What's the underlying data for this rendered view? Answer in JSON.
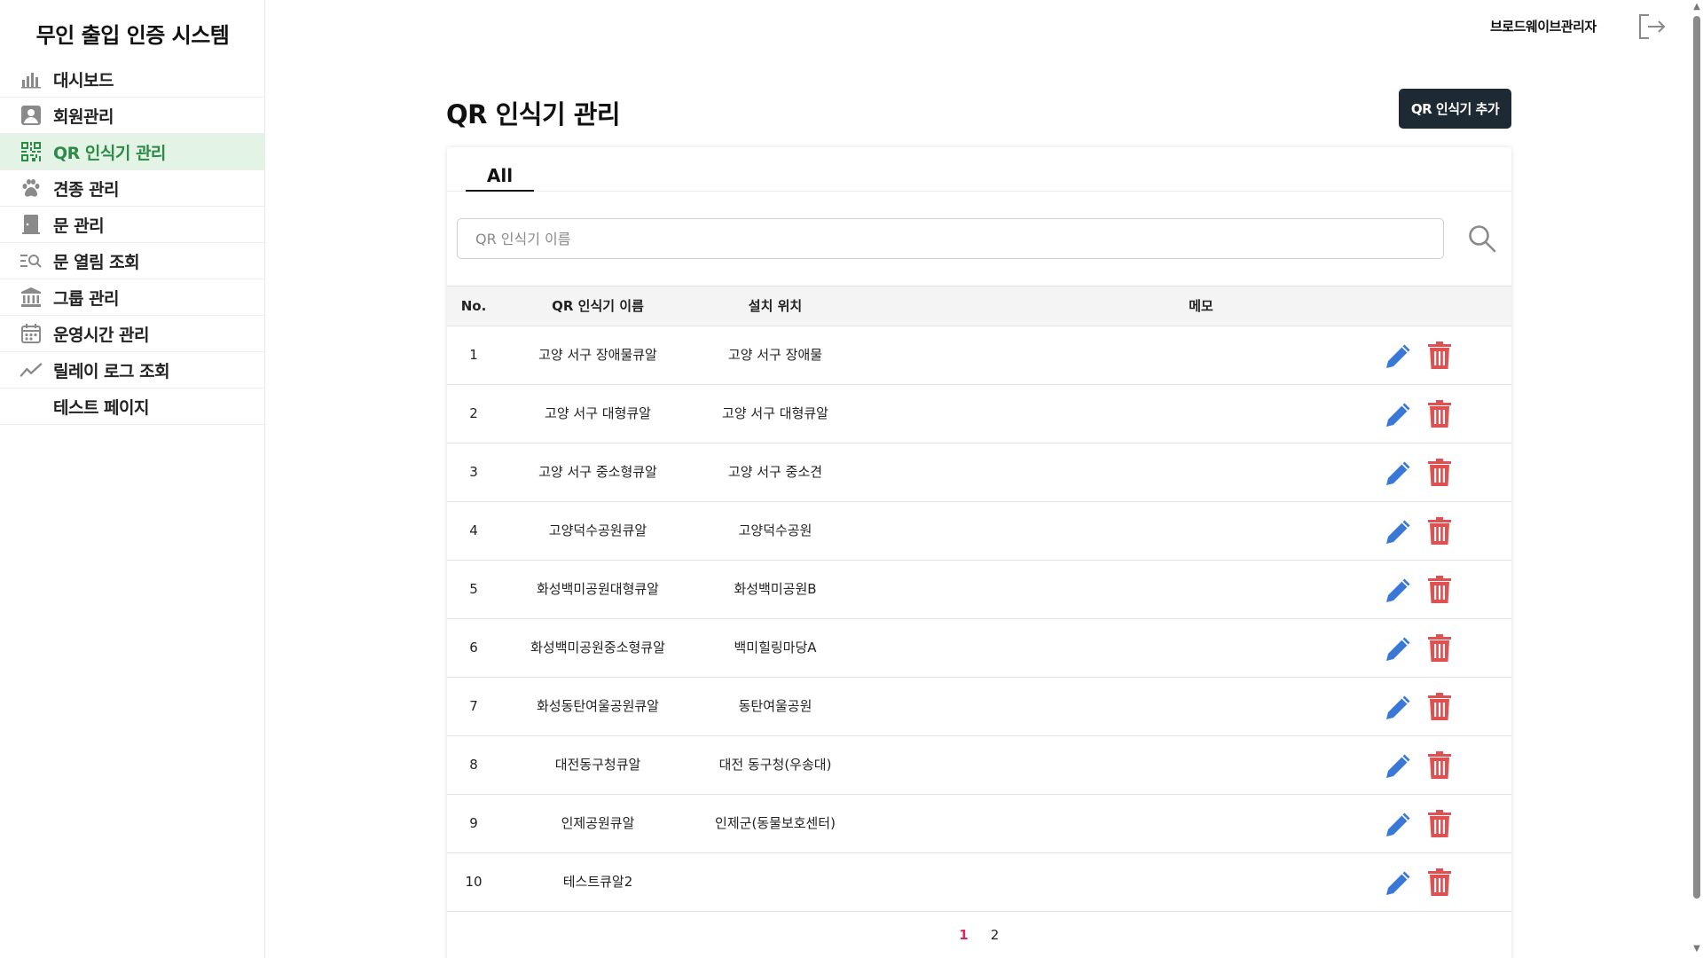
{
  "app": {
    "title": "무인 출입 인증 시스템"
  },
  "sidebar": {
    "items": [
      {
        "label": "대시보드",
        "icon": "bar-chart-icon",
        "active": false
      },
      {
        "label": "회원관리",
        "icon": "user-card-icon",
        "active": false
      },
      {
        "label": "QR 인식기 관리",
        "icon": "qr-code-icon",
        "active": true
      },
      {
        "label": "견종 관리",
        "icon": "paw-icon",
        "active": false
      },
      {
        "label": "문 관리",
        "icon": "door-icon",
        "active": false
      },
      {
        "label": "문 열림 조회",
        "icon": "list-search-icon",
        "active": false
      },
      {
        "label": "그룹 관리",
        "icon": "institution-icon",
        "active": false
      },
      {
        "label": "운영시간 관리",
        "icon": "calendar-icon",
        "active": false
      },
      {
        "label": "릴레이 로그 조회",
        "icon": "trend-line-icon",
        "active": false
      },
      {
        "label": "테스트 페이지",
        "icon": "",
        "active": false
      }
    ]
  },
  "header": {
    "admin_name": "브로드웨이브관리자",
    "logout_icon": "logout-icon"
  },
  "main": {
    "title": "QR 인식기 관리",
    "add_button": "QR 인식기 추가",
    "tabs": [
      {
        "label": "All"
      }
    ],
    "search": {
      "placeholder": "QR 인식기 이름",
      "value": ""
    },
    "table": {
      "columns": [
        "No.",
        "QR 인식기 이름",
        "설치 위치",
        "메모"
      ],
      "rows": [
        {
          "no": "1",
          "name": "고양 서구 장애물큐알",
          "location": "고양 서구 장애물",
          "memo": ""
        },
        {
          "no": "2",
          "name": "고양 서구 대형큐알",
          "location": "고양 서구 대형큐알",
          "memo": ""
        },
        {
          "no": "3",
          "name": "고양 서구 중소형큐알",
          "location": "고양 서구 중소견",
          "memo": ""
        },
        {
          "no": "4",
          "name": "고양덕수공원큐알",
          "location": "고양덕수공원",
          "memo": ""
        },
        {
          "no": "5",
          "name": "화성백미공원대형큐알",
          "location": "화성백미공원B",
          "memo": ""
        },
        {
          "no": "6",
          "name": "화성백미공원중소형큐알",
          "location": "백미힐링마당A",
          "memo": ""
        },
        {
          "no": "7",
          "name": "화성동탄여울공원큐알",
          "location": "동탄여울공원",
          "memo": ""
        },
        {
          "no": "8",
          "name": "대전동구청큐알",
          "location": "대전 동구청(우송대)",
          "memo": ""
        },
        {
          "no": "9",
          "name": "인제공원큐알",
          "location": "인제군(동물보호센터)",
          "memo": ""
        },
        {
          "no": "10",
          "name": "테스트큐알2",
          "location": "",
          "memo": ""
        }
      ]
    },
    "pagination": {
      "pages": [
        "1",
        "2"
      ],
      "current": "1"
    }
  },
  "colors": {
    "active_green": "#2e8b47",
    "active_bg": "#e3f3e6",
    "button_dark": "#1e2a33",
    "edit_blue": "#3a78d8",
    "delete_red": "#e05050",
    "page_current": "#e0245e"
  }
}
